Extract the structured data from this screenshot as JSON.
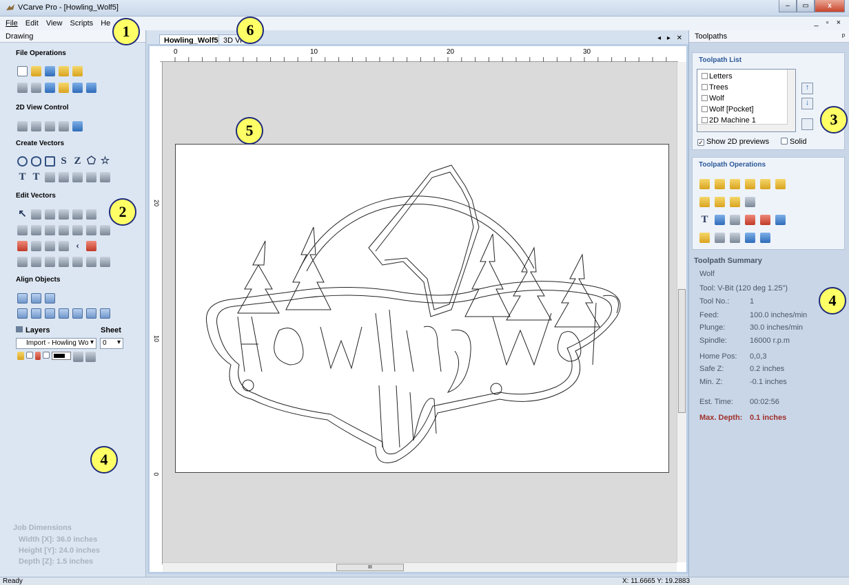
{
  "window": {
    "title": "VCarve Pro - [Howling_Wolf5]",
    "minimize": "–",
    "maximize": "▭",
    "close": "x"
  },
  "menu": {
    "items": [
      "File",
      "Edit",
      "View",
      "Scripts",
      "He"
    ],
    "mdi_controls": "_ ▫ ×"
  },
  "drawing_panel": {
    "title": "Drawing",
    "sections": {
      "file_operations": "File Operations",
      "view_control": "2D View Control",
      "create_vectors": "Create Vectors",
      "edit_vectors": "Edit Vectors",
      "align_objects": "Align Objects"
    },
    "layers": {
      "label": "Layers",
      "sheet_label": "Sheet",
      "current_layer": "Import - Howling Wo",
      "sheet_value": "0"
    },
    "job_dimensions": {
      "title": "Job Dimensions",
      "width": "Width  [X]: 36.0 inches",
      "height": "Height [Y]: 24.0 inches",
      "depth": "Depth  [Z]: 1.5 inches"
    }
  },
  "tabs": [
    {
      "label": "Howling_Wolf5"
    },
    {
      "label": "3D Vi"
    }
  ],
  "tab_controls": "◂ ▸ ✕",
  "ruler": {
    "h_ticks": [
      "0",
      "10",
      "20",
      "30"
    ],
    "v_ticks": [
      "20",
      "10",
      "0"
    ]
  },
  "scroll_grip": "III",
  "toolpaths_panel": {
    "title": "Toolpaths",
    "pin": "ᵖ",
    "list_header": "Toolpath List",
    "items": [
      "Letters",
      "Trees",
      "Wolf",
      "Wolf [Pocket]",
      "2D Machine 1"
    ],
    "show_previews": "Show 2D previews",
    "solid": "Solid",
    "operations_header": "Toolpath Operations",
    "summary": {
      "header": "Toolpath Summary",
      "name": "Wolf",
      "tool": "Tool: V-Bit (120 deg 1.25\")",
      "rows": [
        {
          "label": "Tool No.:",
          "value": "1"
        },
        {
          "label": "Feed:",
          "value": "100.0 inches/min"
        },
        {
          "label": "Plunge:",
          "value": "30.0 inches/min"
        },
        {
          "label": "Spindle:",
          "value": "16000 r.p.m"
        },
        {
          "label": "Home Pos:",
          "value": "0,0,3"
        },
        {
          "label": "Safe Z:",
          "value": "0.2 inches"
        },
        {
          "label": "Min. Z:",
          "value": "-0.1 inches"
        },
        {
          "label": "Est. Time:",
          "value": "00:02:56"
        }
      ],
      "max_depth_label": "Max. Depth:",
      "max_depth_value": "0.1 inches"
    }
  },
  "callouts": [
    "1",
    "2",
    "3",
    "4",
    "4",
    "5",
    "6"
  ],
  "status": {
    "left": "Ready",
    "coords": "X: 11.6665 Y: 19.2883"
  },
  "colors": {
    "callout_fill": "#ffff66",
    "callout_border": "#1e2a7a",
    "max_depth": "#a0302a",
    "section_header": "#2a5796"
  }
}
